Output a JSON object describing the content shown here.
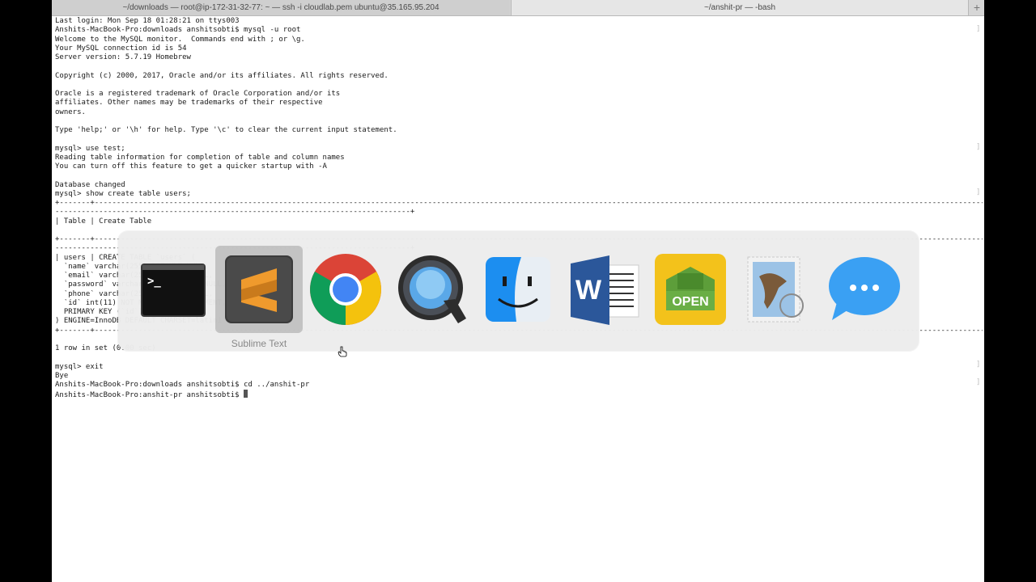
{
  "tabs": [
    {
      "label": "~/downloads — root@ip-172-31-32-77: ~ — ssh -i cloudlab.pem ubuntu@35.165.95.204"
    },
    {
      "label": "~/anshit-pr — -bash"
    }
  ],
  "tab_add_label": "+",
  "terminal_lines": [
    "Last login: Mon Sep 18 01:28:21 on ttys003",
    "Anshits-MacBook-Pro:downloads anshitsobti$ mysql -u root",
    "Welcome to the MySQL monitor.  Commands end with ; or \\g.",
    "Your MySQL connection id is 54",
    "Server version: 5.7.19 Homebrew",
    "",
    "Copyright (c) 2000, 2017, Oracle and/or its affiliates. All rights reserved.",
    "",
    "Oracle is a registered trademark of Oracle Corporation and/or its",
    "affiliates. Other names may be trademarks of their respective",
    "owners.",
    "",
    "Type 'help;' or '\\h' for help. Type '\\c' to clear the current input statement.",
    "",
    "mysql> use test;",
    "Reading table information for completion of table and column names",
    "You can turn off this feature to get a quicker startup with -A",
    "",
    "Database changed",
    "mysql> show create table users;",
    "+-------+--------------------------------------------------------------------------------------------------------------------------------------------------------------------------------------------------------------+",
    "---------------------------------------------------------------------------------+",
    "| Table | Create Table",
    "",
    "+-------+--------------------------------------------------------------------------------------------------------------------------------------------------------------------------------------------------------------+",
    "---------------------------------------------------------------------------------+",
    "| users | CREATE TABLE `users` (",
    "  `name` varchar(255) DEFAULT NULL,",
    "  `email` varchar(255) DEFAULT NULL,",
    "  `password` varchar(255) DEFAULT NULL,",
    "  `phone` varchar(255) DEFAULT NULL,",
    "  `id` int(11) NOT NULL AUTO_INCREMENT,",
    "  PRIMARY KEY (`id`)",
    ") ENGINE=InnoDB DEFAULT CHARSET=latin1 |",
    "+-------+--------------------------------------------------------------------------------------------------------------------------------------------------------------------------------------------------------------+",
    "",
    "1 row in set (0.00 sec)",
    "",
    "mysql> exit",
    "Bye",
    "Anshits-MacBook-Pro:downloads anshitsobti$ cd ../anshit-pr",
    "Anshits-MacBook-Pro:anshit-pr anshitsobti$ "
  ],
  "app_switcher": {
    "selected_label": "Sublime Text",
    "apps": [
      {
        "icon": "terminal-icon"
      },
      {
        "icon": "sublime-text-icon"
      },
      {
        "icon": "chrome-icon"
      },
      {
        "icon": "quicktime-icon"
      },
      {
        "icon": "finder-icon"
      },
      {
        "icon": "word-icon"
      },
      {
        "icon": "open-icon",
        "text": "OPEN"
      },
      {
        "icon": "mail-icon"
      },
      {
        "icon": "messages-icon"
      }
    ]
  },
  "colors": {
    "sublime_orange": "#ef9a2d",
    "chrome_red": "#db4437",
    "chrome_yellow": "#f4c20d",
    "chrome_green": "#0f9d58",
    "chrome_blue": "#4285f4",
    "word_blue": "#2b579a",
    "open_yellow": "#f3c21b",
    "open_green": "#5d9e3a",
    "messages_blue": "#3aa0f3"
  }
}
